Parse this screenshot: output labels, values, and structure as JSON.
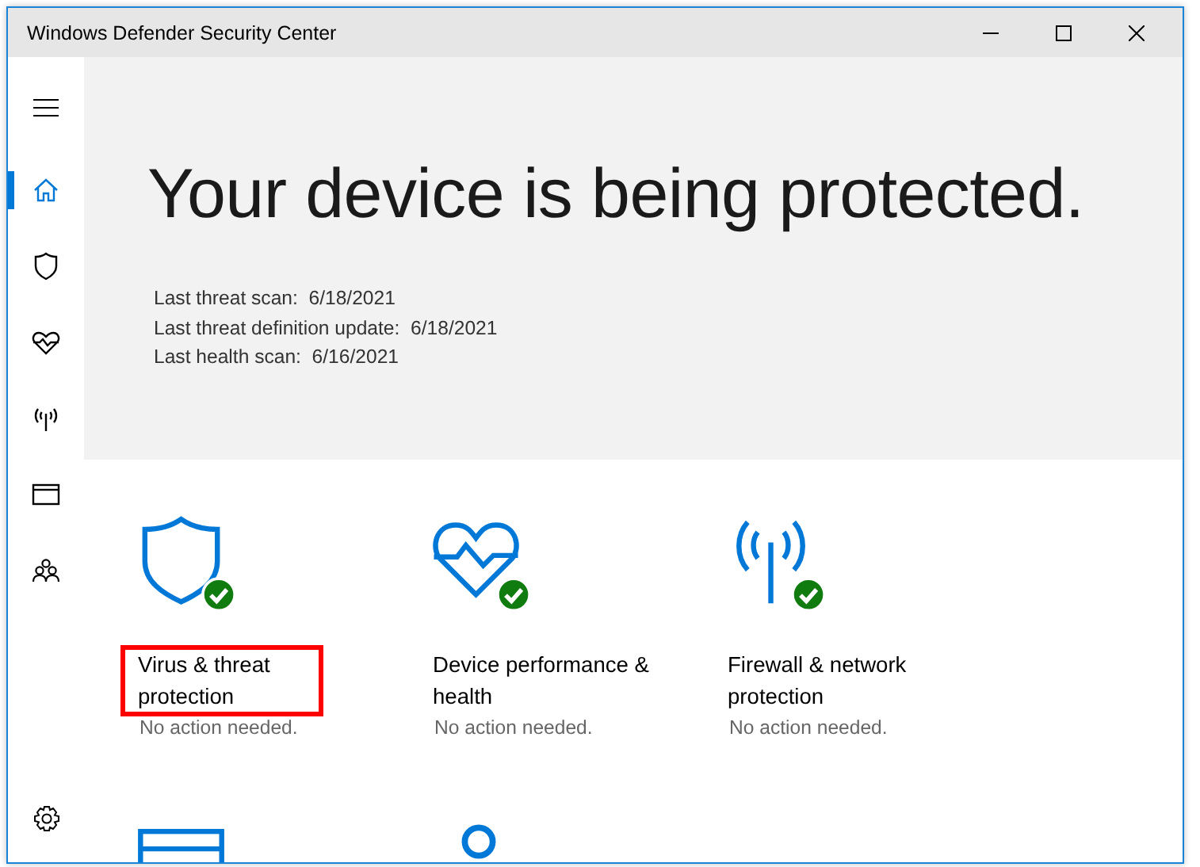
{
  "window": {
    "title": "Windows Defender Security Center"
  },
  "nav": [
    {
      "kind": "home",
      "selected": true
    },
    {
      "kind": "shield",
      "selected": false
    },
    {
      "kind": "heart",
      "selected": false
    },
    {
      "kind": "antenna",
      "selected": false
    },
    {
      "kind": "browser",
      "selected": false
    },
    {
      "kind": "family",
      "selected": false
    }
  ],
  "hero": {
    "title": "Your device is being protected.",
    "scans": [
      {
        "label": "Last threat scan:",
        "value": "6/18/2021"
      },
      {
        "label": "Last threat definition update:",
        "value": "6/18/2021"
      },
      {
        "label": "Last health scan:",
        "value": "6/16/2021"
      }
    ]
  },
  "tiles": [
    {
      "kind": "shield",
      "title": "Virus & threat protection",
      "status": "No action needed.",
      "highlighted": true
    },
    {
      "kind": "heart",
      "title": "Device performance & health",
      "status": "No action needed.",
      "highlighted": false
    },
    {
      "kind": "antenna",
      "title": "Firewall & network protection",
      "status": "No action needed.",
      "highlighted": false
    },
    {
      "kind": "browser"
    },
    {
      "kind": "family"
    }
  ]
}
